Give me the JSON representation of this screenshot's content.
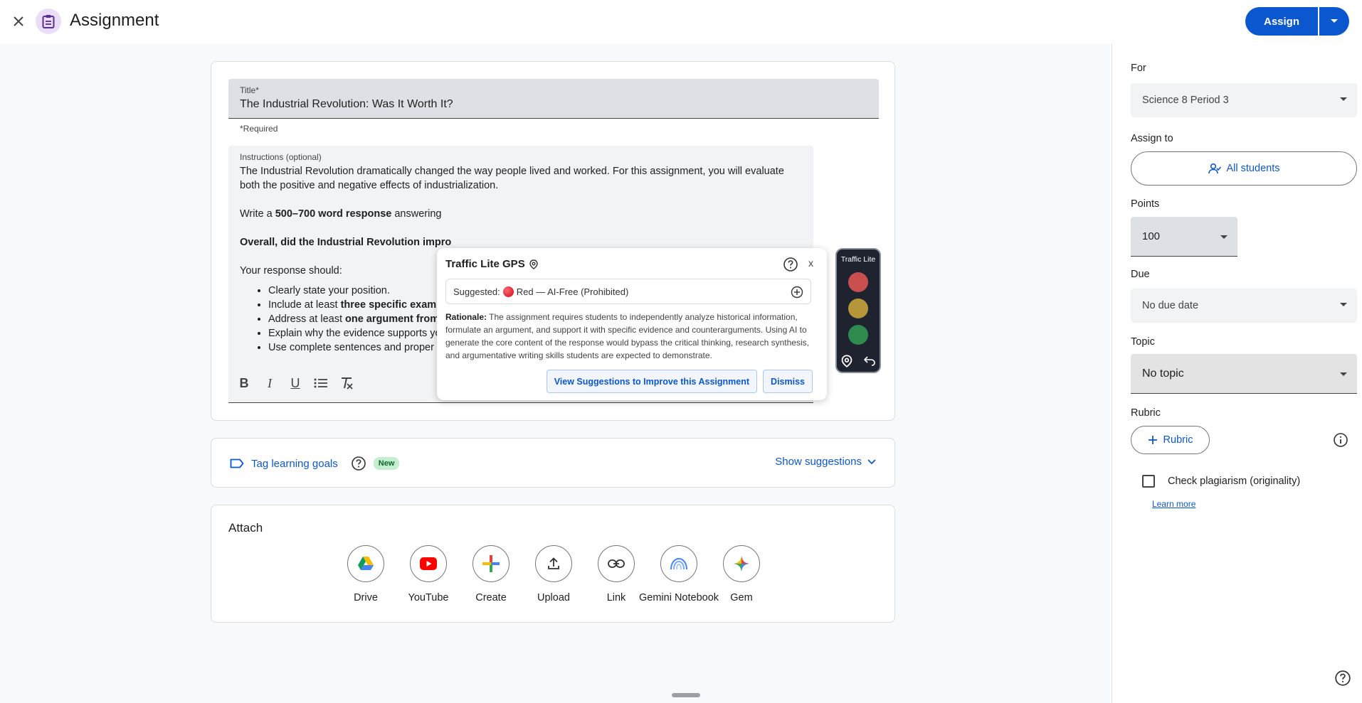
{
  "header": {
    "title": "Assignment",
    "assign_label": "Assign"
  },
  "form": {
    "title_label": "Title*",
    "title_value": "The Industrial Revolution: Was It Worth It?",
    "required_note": "*Required",
    "instructions_label": "Instructions (optional)",
    "instructions": {
      "p1": "The Industrial Revolution dramatically changed the way people lived and worked. For this assignment, you will evaluate both the positive and negative effects of industrialization.",
      "p2_prefix": "Write a ",
      "p2_bold": "500–700 word response",
      "p2_suffix": " answering",
      "p3_bold": "Overall, did the Industrial Revolution impro",
      "p4": "Your response should:",
      "bullets": [
        {
          "prefix": "Clearly state your position.",
          "bold": "",
          "suffix": ""
        },
        {
          "prefix": "Include at least ",
          "bold": "three specific examp",
          "suffix": ""
        },
        {
          "prefix": "Address at least ",
          "bold": "one argument from",
          "suffix": ""
        },
        {
          "prefix": "Explain why the evidence supports yo",
          "bold": "",
          "suffix": ""
        },
        {
          "prefix": "Use complete sentences and proper g",
          "bold": "",
          "suffix": ""
        }
      ]
    },
    "toolbar": [
      "B",
      "I",
      "U"
    ]
  },
  "gps": {
    "title": "Traffic Lite GPS",
    "close": "x",
    "suggested_label": "Suggested:",
    "suggested_value": "Red — AI-Free (Prohibited)",
    "rationale_label": "Rationale:",
    "rationale_text": "The assignment requires students to independently analyze historical information, formulate an argument, and support it with specific evidence and counterarguments. Using AI to generate the core content of the response would bypass the critical thinking, research synthesis, and argumentative writing skills students are expected to demonstrate.",
    "view_button": "View Suggestions to Improve this Assignment",
    "dismiss_button": "Dismiss",
    "widget_label": "Traffic Lite"
  },
  "goals": {
    "tag_label": "Tag learning goals",
    "new_badge": "New",
    "show_suggestions": "Show suggestions"
  },
  "attach": {
    "title": "Attach",
    "items": [
      "Drive",
      "YouTube",
      "Create",
      "Upload",
      "Link",
      "Gemini Notebook",
      "Gem"
    ]
  },
  "sidebar": {
    "for_label": "For",
    "for_value": "Science 8 Period 3",
    "assign_to_label": "Assign to",
    "assign_to_value": "All students",
    "points_label": "Points",
    "points_value": "100",
    "due_label": "Due",
    "due_value": "No due date",
    "topic_label": "Topic",
    "topic_value": "No topic",
    "rubric_label": "Rubric",
    "rubric_button": "Rubric",
    "plagiarism_label": "Check plagiarism (originality)",
    "learn_more": "Learn more"
  },
  "colors": {
    "accent": "#0b57d0",
    "red_light": "#c94f4f",
    "yellow_light": "#b6963a",
    "green_light": "#2f8a4e"
  }
}
